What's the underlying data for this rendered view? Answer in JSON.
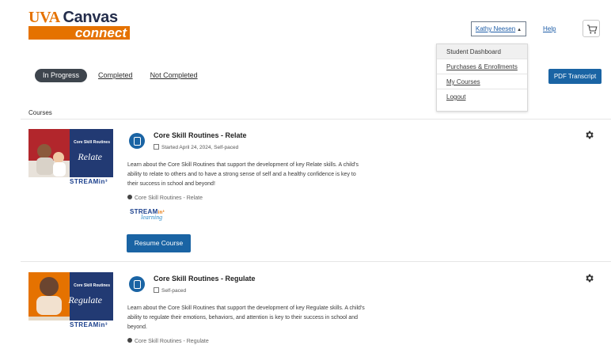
{
  "header": {
    "logo_top_uva": "UVA",
    "logo_top_canvas": "Canvas",
    "logo_bottom": "connect",
    "user_menu_label": "Kathy Neesen",
    "help_label": "Help",
    "cart_icon": "cart-icon"
  },
  "dropdown": {
    "items": [
      {
        "label": "Student Dashboard"
      },
      {
        "label": "Purchases & Enrollments"
      },
      {
        "label": "My Courses"
      },
      {
        "label": "Logout"
      }
    ]
  },
  "tabs": [
    {
      "label": "In Progress",
      "active": true
    },
    {
      "label": "Completed"
    },
    {
      "label": "Not Completed"
    }
  ],
  "pdf_button": "PDF Transcript",
  "section_label": "Courses",
  "courses": [
    {
      "thumb_title": "Core Skill Routines",
      "thumb_script": "Relate",
      "thumb_stream": "STREAMin³",
      "title": "Core Skill Routines - Relate",
      "meta": "Started April 24, 2024, Self-paced",
      "description": "Learn about the Core Skill Routines that support the development of key Relate skills. A child's ability to relate to others and to have a strong sense of self and a healthy confidence is key to their success in school and beyond!",
      "tag": "Core Skill Routines - Relate",
      "logo_text_1": "STREAM",
      "logo_text_sup": "in³",
      "logo_text_2": "learning",
      "button": "Resume Course"
    },
    {
      "thumb_title": "Core Skill Routines",
      "thumb_script": "Regulate",
      "thumb_stream": "STREAMin³",
      "title": "Core Skill Routines - Regulate",
      "meta": "Self-paced",
      "description": "Learn about the Core Skill Routines that support the development of key Regulate skills. A child's ability to regulate their emotions, behaviors, and attention is key to their success in school and beyond.",
      "tag": "Core Skill Routines - Regulate"
    }
  ],
  "colors": {
    "brand_orange": "#e57200",
    "brand_navy": "#232d4b",
    "primary_blue": "#1a64a4"
  }
}
